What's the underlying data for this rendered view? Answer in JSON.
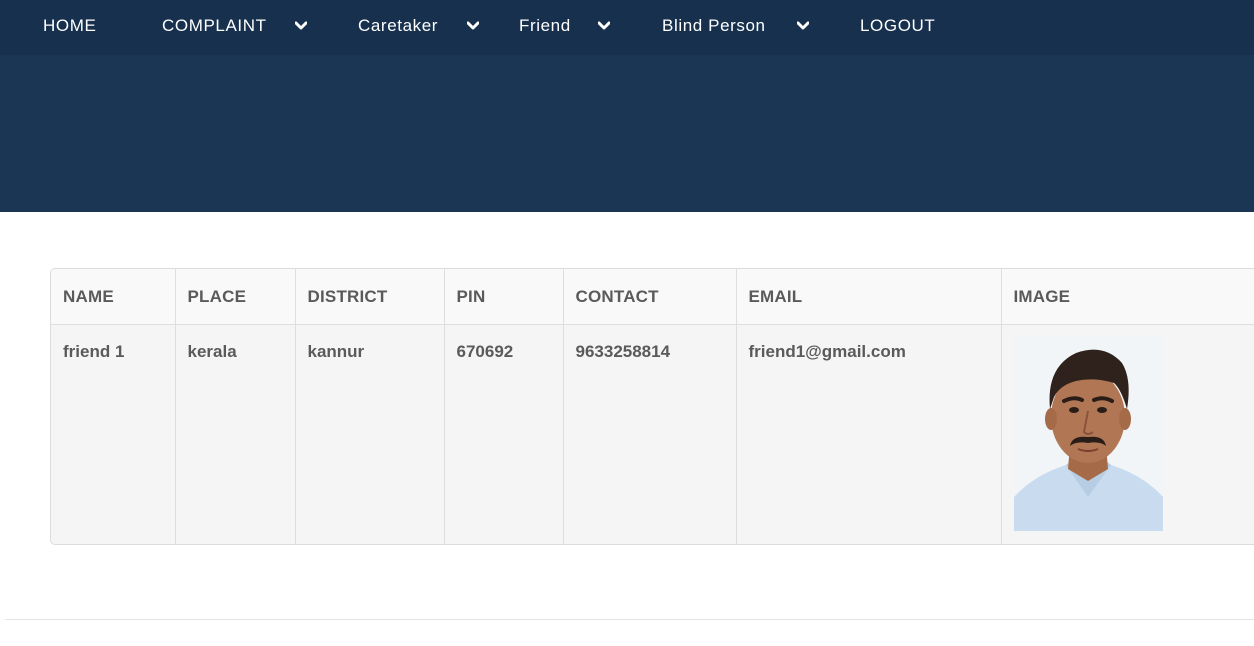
{
  "nav": {
    "home": "HOME",
    "complaint": "COMPLAINT",
    "caretaker": "Caretaker",
    "friend": "Friend",
    "blind_person": "Blind Person",
    "logout": "LOGOUT"
  },
  "colors": {
    "nav_bg": "#16304d",
    "hero_bg": "#1b3654",
    "text": "#5a5a5a"
  },
  "table": {
    "headers": [
      "NAME",
      "PLACE",
      "DISTRICT",
      "PIN",
      "CONTACT",
      "EMAIL",
      "IMAGE"
    ],
    "rows": [
      {
        "name": "friend 1",
        "place": "kerala",
        "district": "kannur",
        "pin": "670692",
        "contact": "9633258814",
        "email": "friend1@gmail.com"
      }
    ]
  }
}
